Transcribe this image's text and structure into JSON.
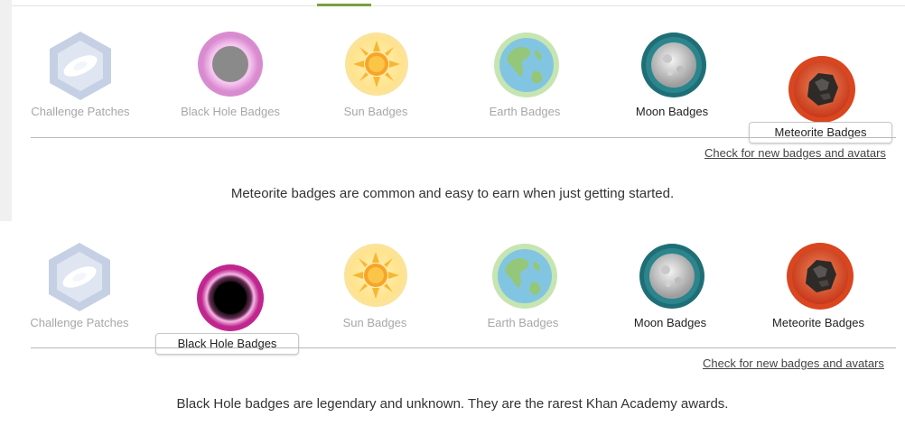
{
  "sections": [
    {
      "badges": [
        {
          "label": "Challenge Patches",
          "icon": "challenge-patch-icon",
          "selected": false
        },
        {
          "label": "Black Hole Badges",
          "icon": "black-hole-icon",
          "selected": false
        },
        {
          "label": "Sun Badges",
          "icon": "sun-icon",
          "selected": false
        },
        {
          "label": "Earth Badges",
          "icon": "earth-icon",
          "selected": false
        },
        {
          "label": "Moon Badges",
          "icon": "moon-icon",
          "selected": false
        },
        {
          "label": "Meteorite Badges",
          "icon": "meteorite-icon",
          "selected": true
        }
      ],
      "link": "Check for new badges and avatars",
      "description": "Meteorite badges are common and easy to earn when just getting started."
    },
    {
      "badges": [
        {
          "label": "Challenge Patches",
          "icon": "challenge-patch-icon",
          "selected": false
        },
        {
          "label": "Black Hole Badges",
          "icon": "black-hole-icon",
          "selected": true
        },
        {
          "label": "Sun Badges",
          "icon": "sun-icon",
          "selected": false
        },
        {
          "label": "Earth Badges",
          "icon": "earth-icon",
          "selected": false
        },
        {
          "label": "Moon Badges",
          "icon": "moon-icon",
          "selected": false
        },
        {
          "label": "Meteorite Badges",
          "icon": "meteorite-icon",
          "selected": false
        }
      ],
      "link": "Check for new badges and avatars",
      "description": "Black Hole badges are legendary and unknown. They are the rarest Khan Academy awards."
    }
  ],
  "colors": {
    "accent": "#7aa03a",
    "link": "#444444",
    "rule": "#b9b9b9"
  }
}
